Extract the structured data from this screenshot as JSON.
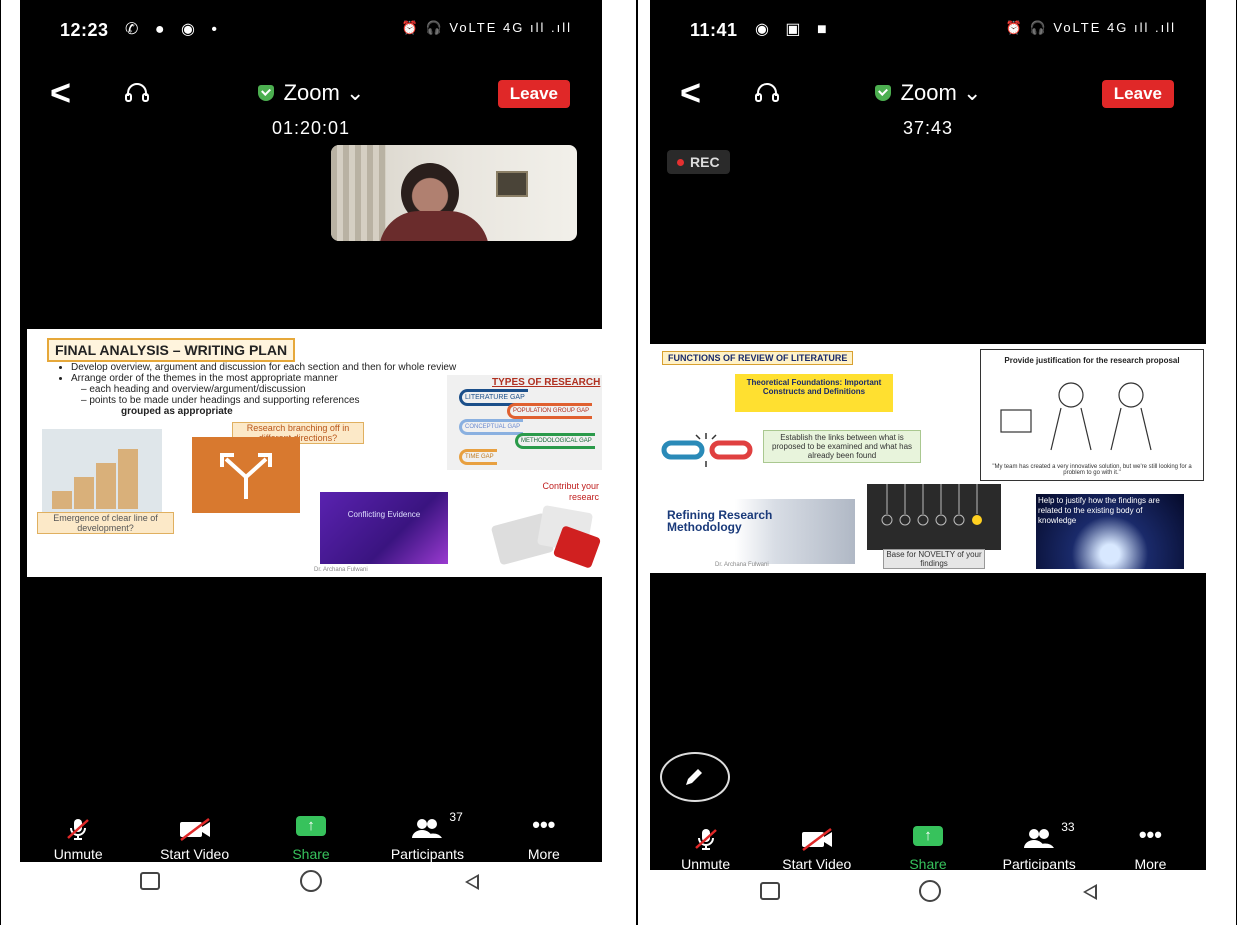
{
  "left": {
    "status": {
      "time": "12:23",
      "right_icons": "⏰ 🎧 VoLTE 4G ıll .ıll"
    },
    "meeting_title": "Zoom",
    "timer": "01:20:01",
    "leave_label": "Leave",
    "slide": {
      "title": "FINAL ANALYSIS – WRITING PLAN",
      "bullets": [
        "Develop overview, argument and discussion for each section and then for whole review",
        "Arrange order of the themes in the most appropriate manner",
        "– each heading and overview/argument/discussion",
        "– points to be made under headings and supporting references",
        "grouped as appropriate"
      ],
      "research_branch": "Research branching off in different directions?",
      "emergence": "Emergence of clear line of development?",
      "conflicting": "Conflicting Evidence",
      "contribute": "Contribut your researc",
      "types_title": "TYPES OF RESEARCH",
      "gaps": [
        "LITERATURE GAP",
        "POPULATION GROUP GAP",
        "CONCEPTUAL GAP",
        "METHODOLOGICAL GAP",
        "TIME GAP"
      ],
      "footer": "Dr. Archana Fulwani"
    },
    "toolbar": {
      "unmute": "Unmute",
      "start_video": "Start Video",
      "share": "Share",
      "participants": "Participants",
      "participants_count": "37",
      "more": "More"
    }
  },
  "right": {
    "status": {
      "time": "11:41",
      "right_icons": "⏰ 🎧 VoLTE 4G ıll .ıll"
    },
    "meeting_title": "Zoom",
    "timer": "37:43",
    "leave_label": "Leave",
    "rec_label": "REC",
    "slide": {
      "title": "FUNCTIONS OF REVIEW OF LITERATURE",
      "theoretical": "Theoretical Foundations: Important Constructs and Definitions",
      "links": "Establish the links between what is proposed to be examined and what has already been found",
      "refining": "Refining Research Methodology",
      "novelty": "Base for NOVELTY of your findings",
      "justify_title": "Provide justification for the research proposal",
      "cartoon_caption": "\"My team has created a very innovative solution, but we're still looking for a problem to go with it.\"",
      "help_justify": "Help to justify how the findings are related to the existing body of knowledge",
      "footer": "Dr. Archana Fulwani"
    },
    "toolbar": {
      "unmute": "Unmute",
      "start_video": "Start Video",
      "share": "Share",
      "participants": "Participants",
      "participants_count": "33",
      "more": "More"
    }
  }
}
